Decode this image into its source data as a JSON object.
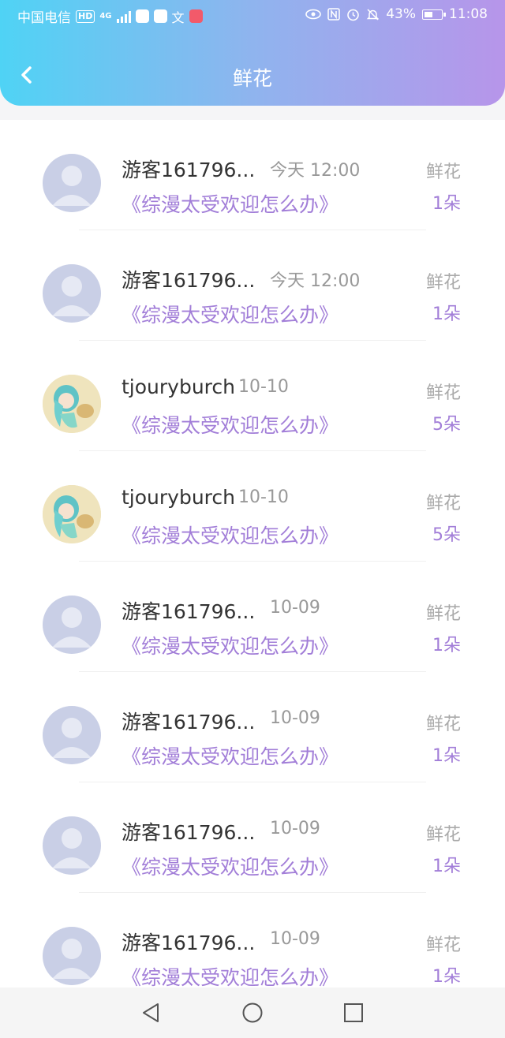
{
  "statusbar": {
    "carrier": "中国电信",
    "hd": "HD",
    "network": "4G",
    "battery": "43%",
    "time": "11:08"
  },
  "header": {
    "title": "鲜花"
  },
  "items": [
    {
      "avatar": "default-avatar",
      "name": "游客161796...",
      "time": "今天 12:00",
      "book": "《综漫太受欢迎怎么办》",
      "label": "鲜花",
      "count": "1朵"
    },
    {
      "avatar": "default-avatar",
      "name": "游客161796...",
      "time": "今天 12:00",
      "book": "《综漫太受欢迎怎么办》",
      "label": "鲜花",
      "count": "1朵"
    },
    {
      "avatar": "anime-avatar",
      "name": "tjouryburch",
      "time": "10-10",
      "book": "《综漫太受欢迎怎么办》",
      "label": "鲜花",
      "count": "5朵"
    },
    {
      "avatar": "anime-avatar",
      "name": "tjouryburch",
      "time": "10-10",
      "book": "《综漫太受欢迎怎么办》",
      "label": "鲜花",
      "count": "5朵"
    },
    {
      "avatar": "default-avatar",
      "name": "游客161796...",
      "time": "10-09",
      "book": "《综漫太受欢迎怎么办》",
      "label": "鲜花",
      "count": "1朵"
    },
    {
      "avatar": "default-avatar",
      "name": "游客161796...",
      "time": "10-09",
      "book": "《综漫太受欢迎怎么办》",
      "label": "鲜花",
      "count": "1朵"
    },
    {
      "avatar": "default-avatar",
      "name": "游客161796...",
      "time": "10-09",
      "book": "《综漫太受欢迎怎么办》",
      "label": "鲜花",
      "count": "1朵"
    },
    {
      "avatar": "default-avatar",
      "name": "游客161796...",
      "time": "10-09",
      "book": "《综漫太受欢迎怎么办》",
      "label": "鲜花",
      "count": "1朵"
    }
  ],
  "navbar": {
    "icons": [
      "back-triangle-icon",
      "home-circle-icon",
      "recents-square-icon"
    ]
  },
  "colors": {
    "accent": "#a27ed8",
    "header_start": "#4fd3f5",
    "header_end": "#b795ea"
  }
}
